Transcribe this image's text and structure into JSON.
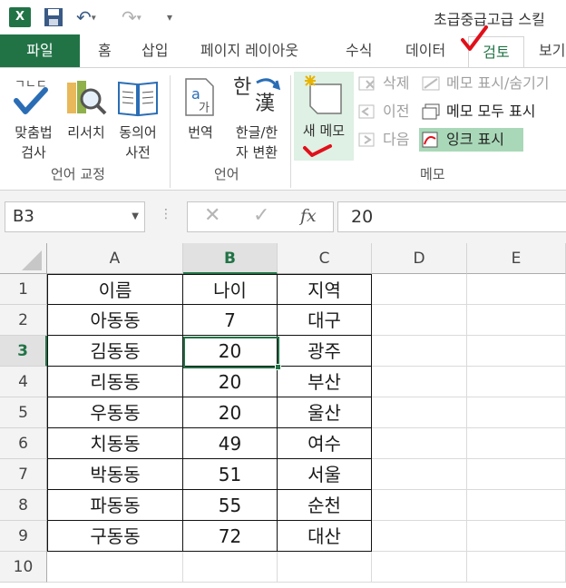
{
  "title": "초급중급고급 스킬",
  "tabs": {
    "file": "파일",
    "home": "홈",
    "insert": "삽입",
    "page_layout": "페이지 레이아웃",
    "formulas": "수식",
    "data": "데이터",
    "review": "검토",
    "view": "보기"
  },
  "ribbon": {
    "proofing": {
      "spelling_line1": "맞춤법",
      "spelling_line2": "검사",
      "research": "리서치",
      "thesaurus_line1": "동의어",
      "thesaurus_line2": "사전",
      "group": "언어 교정"
    },
    "language": {
      "translate": "번역",
      "hanja_line1": "한글/한",
      "hanja_line2": "자 변환",
      "group": "언어"
    },
    "comments": {
      "new_comment": "새 메모",
      "delete": "삭제",
      "previous": "이전",
      "next": "다음",
      "show_hide": "메모 표시/숨기기",
      "show_all": "메모 모두 표시",
      "show_ink": "잉크 표시",
      "group": "메모"
    }
  },
  "formula_bar": {
    "name_box": "B3",
    "fx": "fx",
    "value": "20"
  },
  "columns": [
    "A",
    "B",
    "C",
    "D",
    "E"
  ],
  "rows": [
    "1",
    "2",
    "3",
    "4",
    "5",
    "6",
    "7",
    "8",
    "9",
    "10"
  ],
  "table": {
    "headers": [
      "이름",
      "나이",
      "지역"
    ],
    "data": [
      [
        "아동동",
        "7",
        "대구"
      ],
      [
        "김동동",
        "20",
        "광주"
      ],
      [
        "리동동",
        "20",
        "부산"
      ],
      [
        "우동동",
        "20",
        "울산"
      ],
      [
        "치동동",
        "49",
        "여수"
      ],
      [
        "박동동",
        "51",
        "서울"
      ],
      [
        "파동동",
        "55",
        "순천"
      ],
      [
        "구동동",
        "72",
        "대산"
      ]
    ]
  },
  "selected_cell": "B3",
  "colors": {
    "excel_green": "#217346",
    "highlight": "#dff0e4",
    "ink_annotation": "#e0101a"
  }
}
